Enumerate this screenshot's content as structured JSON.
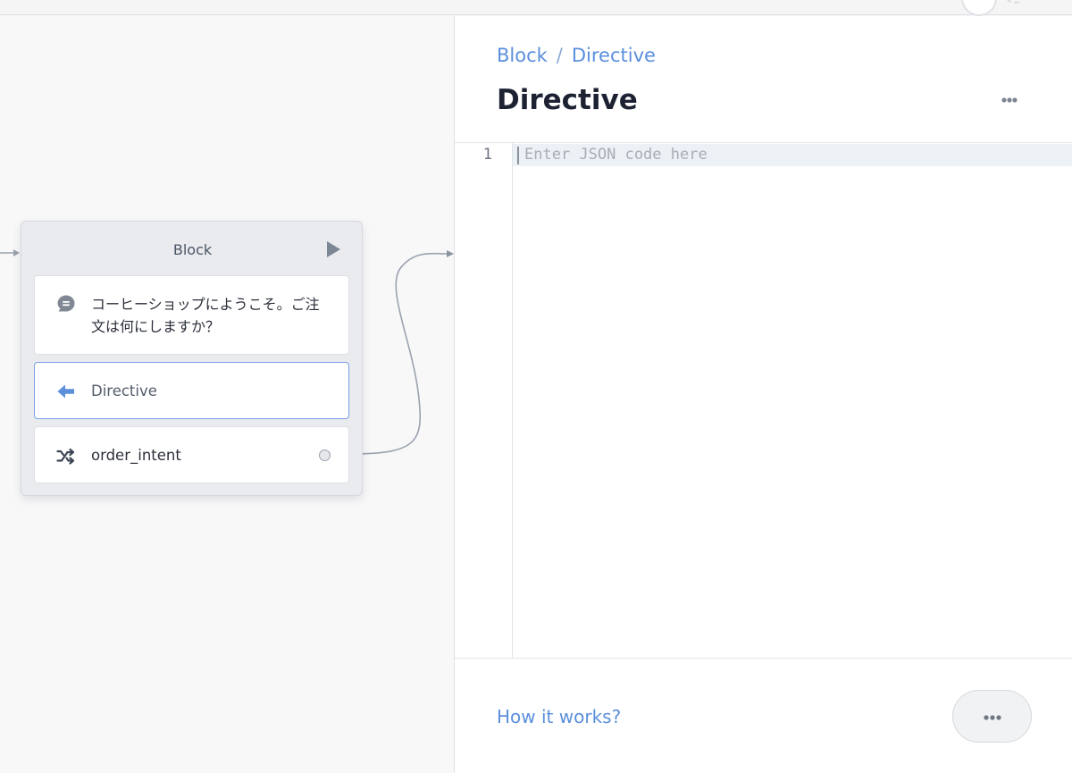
{
  "canvas": {
    "block": {
      "title": "Block",
      "items": [
        {
          "type": "message",
          "icon": "chat-bubble-icon",
          "text": "コーヒーショップにようこそ。ご注文は何にしますか？"
        },
        {
          "type": "directive",
          "icon": "arrow-left-icon",
          "label": "Directive"
        },
        {
          "type": "intent",
          "icon": "shuffle-icon",
          "label": "order_intent"
        }
      ]
    }
  },
  "panel": {
    "breadcrumb": [
      "Block",
      "/",
      "Directive"
    ],
    "title": "Directive",
    "editor": {
      "line_number": "1",
      "placeholder": "Enter JSON code here"
    },
    "footer": {
      "help_link": "How it works?"
    }
  },
  "colors": {
    "accent": "#5b8fdc",
    "selected_border": "#7aa0e6",
    "block_bg": "#e9ebef"
  }
}
